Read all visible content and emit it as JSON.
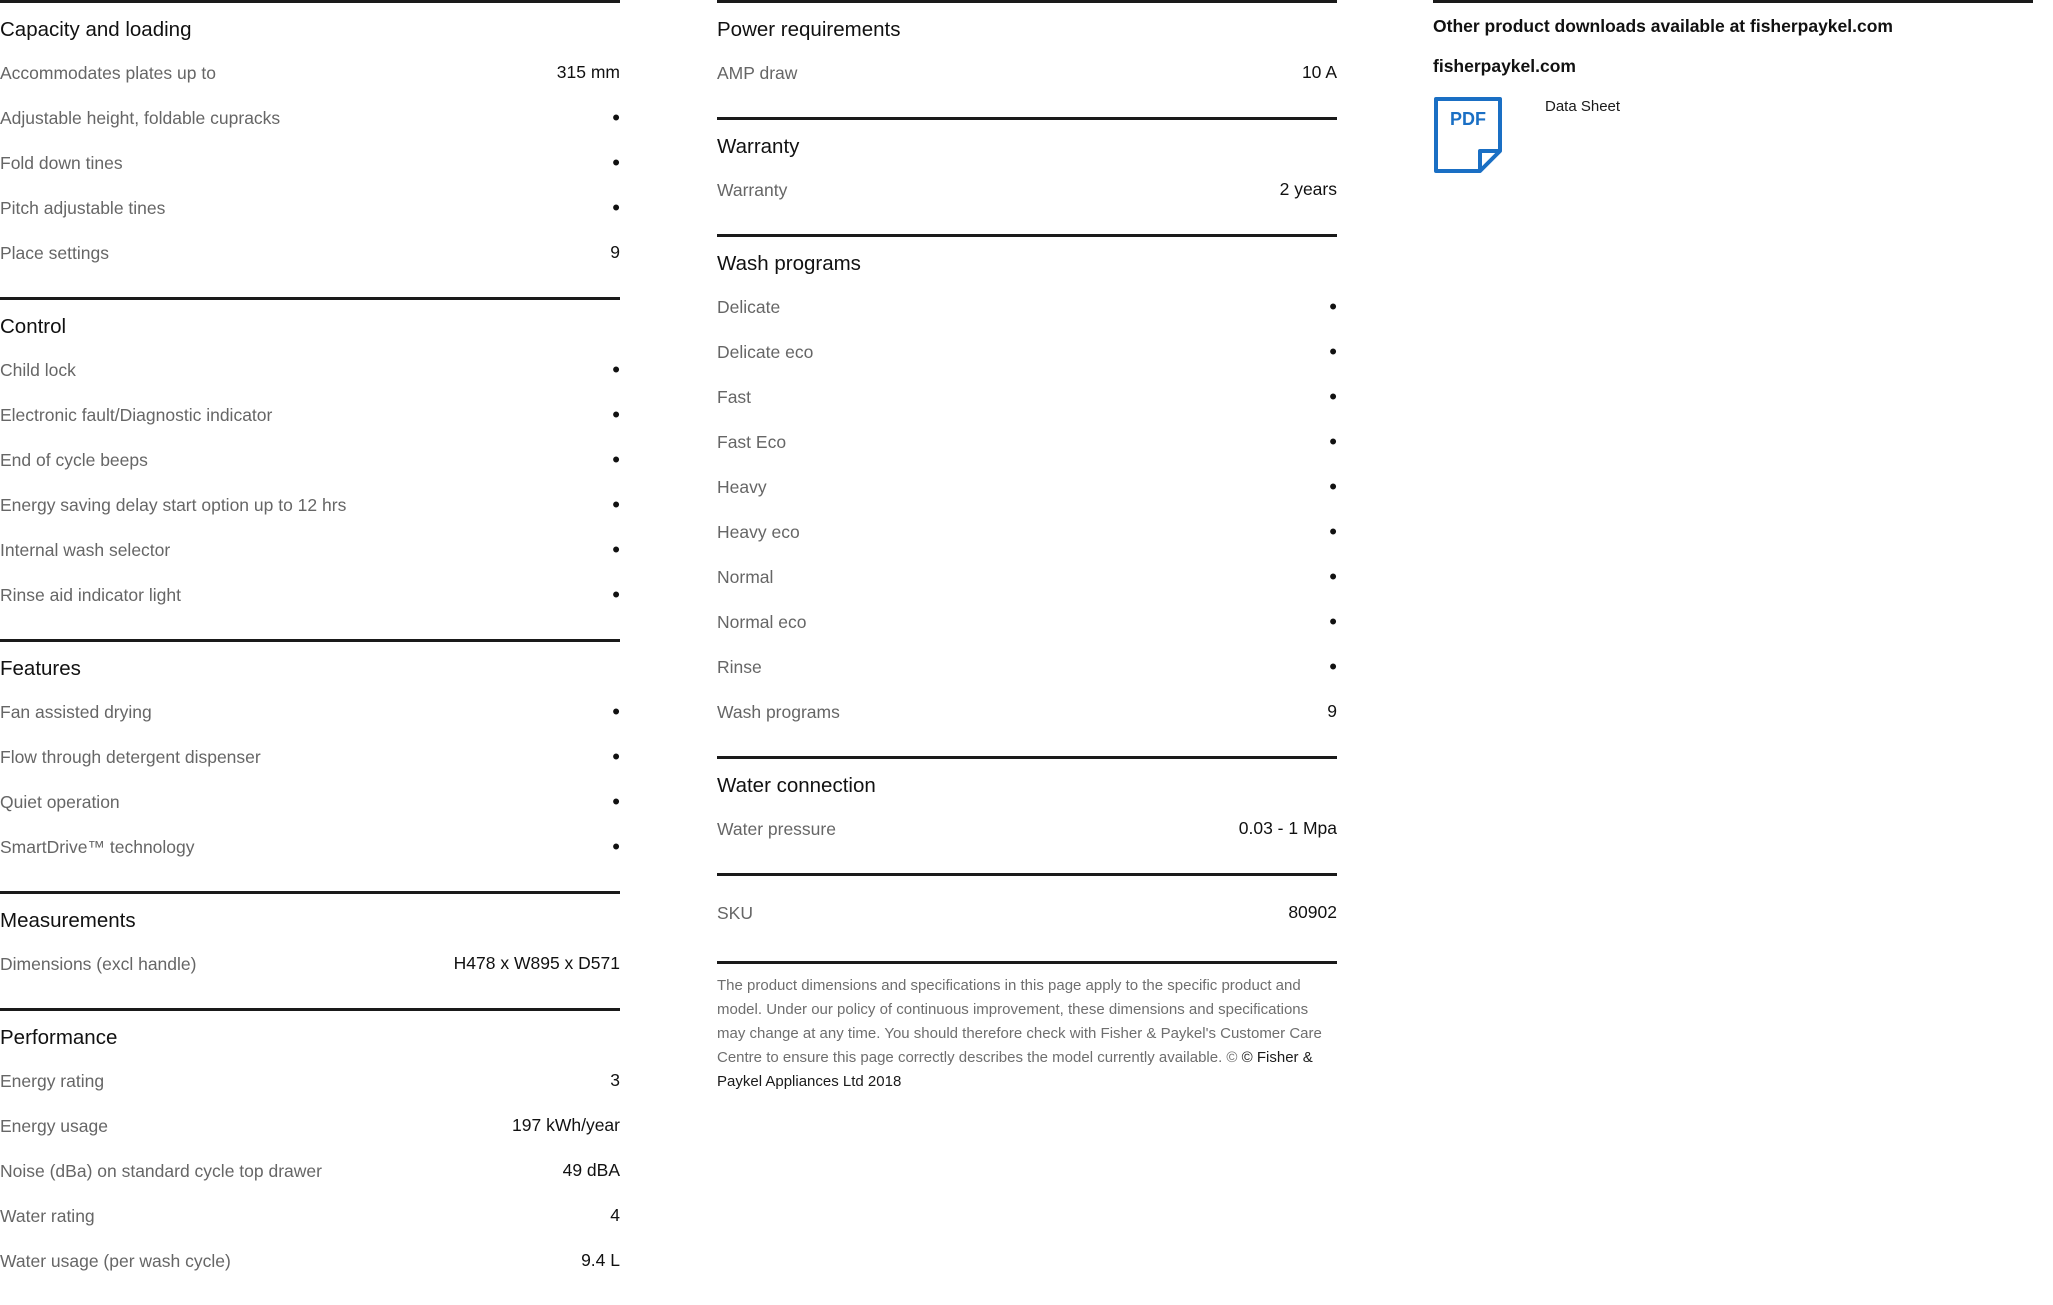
{
  "col1": [
    {
      "title": "Capacity and loading",
      "rows": [
        {
          "label": "Accommodates plates up to",
          "value": "315 mm"
        },
        {
          "label": "Adjustable height, foldable cupracks",
          "value": "•"
        },
        {
          "label": "Fold down tines",
          "value": "•"
        },
        {
          "label": "Pitch adjustable tines",
          "value": "•"
        },
        {
          "label": "Place settings",
          "value": "9"
        }
      ]
    },
    {
      "title": "Control",
      "rows": [
        {
          "label": "Child lock",
          "value": "•"
        },
        {
          "label": "Electronic fault/Diagnostic indicator",
          "value": "•"
        },
        {
          "label": "End of cycle beeps",
          "value": "•"
        },
        {
          "label": "Energy saving delay start option up to 12 hrs",
          "value": "•"
        },
        {
          "label": "Internal wash selector",
          "value": "•"
        },
        {
          "label": "Rinse aid indicator light",
          "value": "•"
        }
      ]
    },
    {
      "title": "Features",
      "rows": [
        {
          "label": "Fan assisted drying",
          "value": "•"
        },
        {
          "label": "Flow through detergent dispenser",
          "value": "•"
        },
        {
          "label": "Quiet operation",
          "value": "•"
        },
        {
          "label": "SmartDrive™ technology",
          "value": "•"
        }
      ]
    },
    {
      "title": "Measurements",
      "rows": [
        {
          "label": "Dimensions (excl handle)",
          "value": "H478 x W895 x D571"
        }
      ]
    },
    {
      "title": "Performance",
      "rows": [
        {
          "label": "Energy rating",
          "value": "3"
        },
        {
          "label": "Energy usage",
          "value": "197 kWh/year"
        },
        {
          "label": "Noise (dBa) on standard cycle top drawer",
          "value": "49 dBA"
        },
        {
          "label": "Water rating",
          "value": "4"
        },
        {
          "label": "Water usage (per wash cycle)",
          "value": "9.4 L"
        }
      ]
    }
  ],
  "col2": [
    {
      "title": "Power requirements",
      "rows": [
        {
          "label": "AMP draw",
          "value": "10 A"
        }
      ]
    },
    {
      "title": "Warranty",
      "rows": [
        {
          "label": "Warranty",
          "value": "2 years"
        }
      ]
    },
    {
      "title": "Wash programs",
      "rows": [
        {
          "label": "Delicate",
          "value": "•"
        },
        {
          "label": "Delicate eco",
          "value": "•"
        },
        {
          "label": "Fast",
          "value": "•"
        },
        {
          "label": "Fast Eco",
          "value": "•"
        },
        {
          "label": "Heavy",
          "value": "•"
        },
        {
          "label": "Heavy eco",
          "value": "•"
        },
        {
          "label": "Normal",
          "value": "•"
        },
        {
          "label": "Normal eco",
          "value": "•"
        },
        {
          "label": "Rinse",
          "value": "•"
        },
        {
          "label": "Wash programs",
          "value": "9"
        }
      ]
    },
    {
      "title": "Water connection",
      "rows": [
        {
          "label": "Water pressure",
          "value": "0.03 - 1 Mpa"
        }
      ]
    },
    {
      "title": "",
      "rows": [
        {
          "label": "SKU",
          "value": "80902"
        }
      ]
    }
  ],
  "disclaimer": {
    "text": "The product dimensions and specifications in this page apply to the specific product and model. Under our policy of continuous improvement, these dimensions and specifications may change at any time. You should therefore check with Fisher & Paykel's Customer Care Centre to ensure this page correctly describes the model currently available. © ",
    "brand": "© Fisher & Paykel Appliances Ltd 2018"
  },
  "downloads": {
    "title": "Other product downloads available at fisherpaykel.com",
    "link": "fisherpaykel.com",
    "pdf_icon_text": "PDF",
    "item_label": "Data Sheet",
    "accent_color": "#1a6fc4"
  }
}
